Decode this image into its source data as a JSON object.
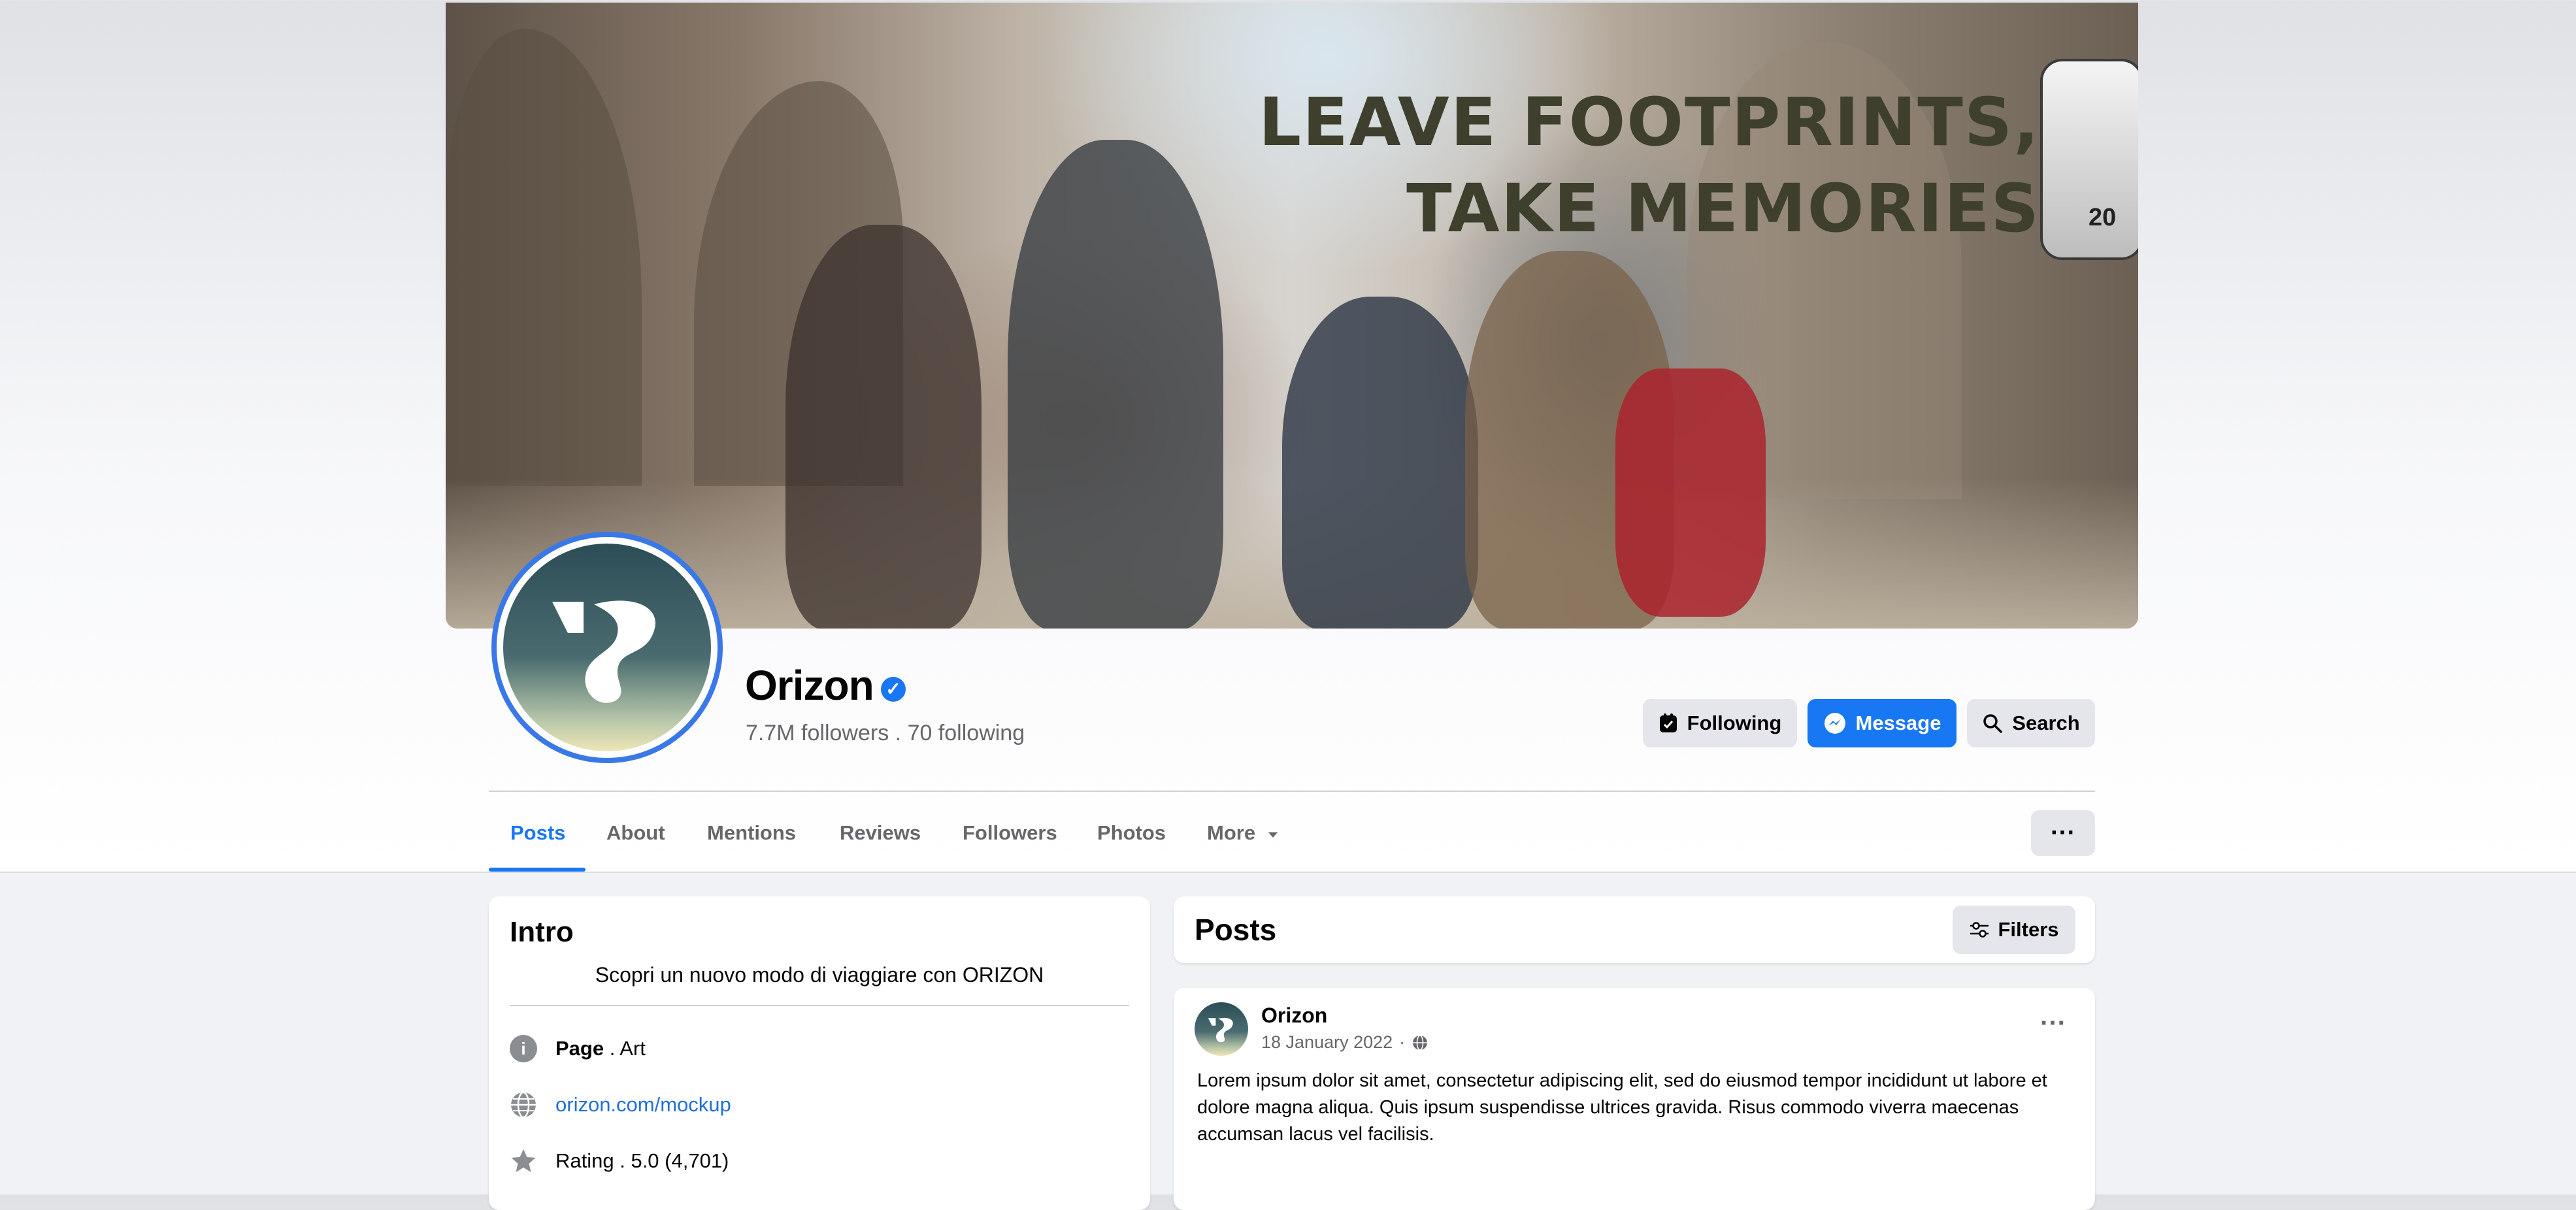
{
  "cover": {
    "headline_line1": "LEAVE FOOTPRINTS,",
    "headline_line2": "TAKE MEMORIES",
    "gondola_number": "20"
  },
  "page": {
    "name": "Orizon",
    "verified": true,
    "followers": "7.7M followers",
    "separator": ".",
    "following": "70 following"
  },
  "actions": {
    "following_label": "Following",
    "message_label": "Message",
    "search_label": "Search"
  },
  "tabs": [
    {
      "label": "Posts",
      "active": true
    },
    {
      "label": "About"
    },
    {
      "label": "Mentions"
    },
    {
      "label": "Reviews"
    },
    {
      "label": "Followers"
    },
    {
      "label": "Photos"
    },
    {
      "label": "More"
    }
  ],
  "intro": {
    "title": "Intro",
    "description": "Scopri un nuovo modo di viaggiare con ORIZON",
    "page_label": "Page",
    "page_category": ". Art",
    "website": "orizon.com/mockup",
    "rating": "Rating . 5.0 (4,701)"
  },
  "posts_section": {
    "title": "Posts",
    "filters_label": "Filters"
  },
  "post": {
    "author": "Orizon",
    "date": "18 January 2022",
    "dot": "·",
    "body": "Lorem ipsum dolor sit amet, consectetur adipiscing elit, sed do eiusmod tempor incididunt ut labore et dolore magna aliqua. Quis ipsum suspendisse ultrices gravida. Risus commodo viverra maecenas accumsan lacus vel facilisis."
  },
  "colors": {
    "accent": "#1877f2",
    "avatar_ring": "#3b78e7",
    "secondary_button": "#e4e6eb",
    "page_background": "#f0f2f5"
  },
  "icons": [
    "verified-badge-icon",
    "following-icon",
    "messenger-icon",
    "search-icon",
    "caret-down-icon",
    "more-options-icon",
    "filters-icon",
    "info-icon",
    "globe-icon",
    "star-icon",
    "public-globe-icon"
  ]
}
